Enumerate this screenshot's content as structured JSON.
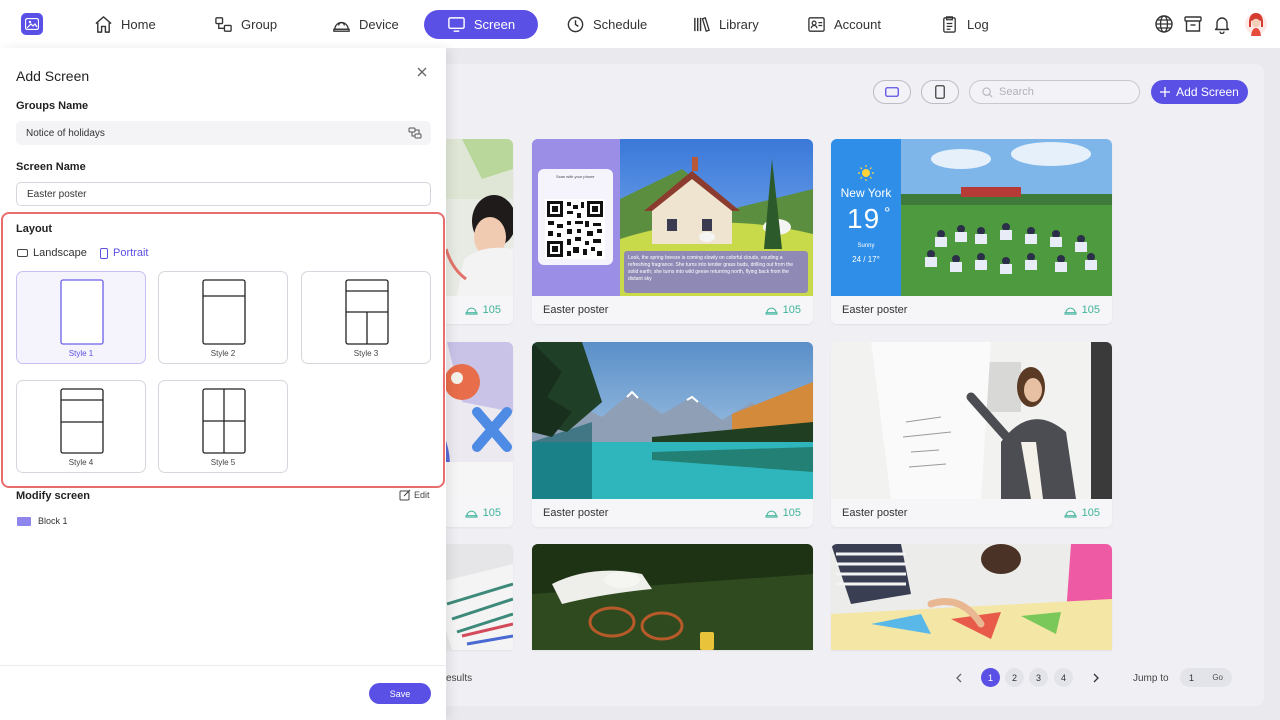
{
  "nav": {
    "items": [
      {
        "label": "Home",
        "icon": "home-icon"
      },
      {
        "label": "Group",
        "icon": "group-icon"
      },
      {
        "label": "Device",
        "icon": "device-icon"
      },
      {
        "label": "Screen",
        "icon": "screen-icon",
        "active": true
      },
      {
        "label": "Schedule",
        "icon": "clock-icon"
      },
      {
        "label": "Library",
        "icon": "library-icon"
      },
      {
        "label": "Account",
        "icon": "account-icon"
      },
      {
        "label": "Log",
        "icon": "log-icon"
      }
    ],
    "accent": "#5b50e6"
  },
  "toolbar": {
    "search_placeholder": "Search",
    "add_label": "Add Screen"
  },
  "cards": [
    {
      "name": "",
      "count": "105"
    },
    {
      "name": "Easter poster",
      "count": "105"
    },
    {
      "name": "Easter poster",
      "count": "105"
    },
    {
      "name": "",
      "count": "105"
    },
    {
      "name": "Easter poster",
      "count": "105"
    },
    {
      "name": "Easter poster",
      "count": "105"
    }
  ],
  "poster_qr": {
    "scan_text": "Scan with your phone",
    "caption": "Look, the spring breeze is coming slowly on colorful clouds, exuding a refreshing fragrance. She turns into tender grass buds, drilling out from the solid earth; she turns into wild geese returning north, flying back from the distant sky"
  },
  "weather": {
    "city": "New York",
    "temp": "19",
    "unit": "°",
    "condition": "Sunny",
    "range": "24 / 17°"
  },
  "pagination": {
    "results_fragment": "esults",
    "pages": [
      "1",
      "2",
      "3",
      "4"
    ],
    "current": "1",
    "jump_label": "Jump to",
    "jump_value": "1",
    "go_label": "Go"
  },
  "panel": {
    "title": "Add Screen",
    "groups_label": "Groups Name",
    "groups_value": "Notice of holidays",
    "screen_label": "Screen Name",
    "screen_value": "Easter poster",
    "layout_label": "Layout",
    "landscape_label": "Landscape",
    "portrait_label": "Portrait",
    "styles": [
      "Style 1",
      "Style 2",
      "Style 3",
      "Style 4",
      "Style 5"
    ],
    "selected_style": "Style 1",
    "modify_label": "Modify screen",
    "edit_label": "Edit",
    "block_label": "Block 1",
    "save_label": "Save",
    "highlight_color": "#e86d6d"
  }
}
